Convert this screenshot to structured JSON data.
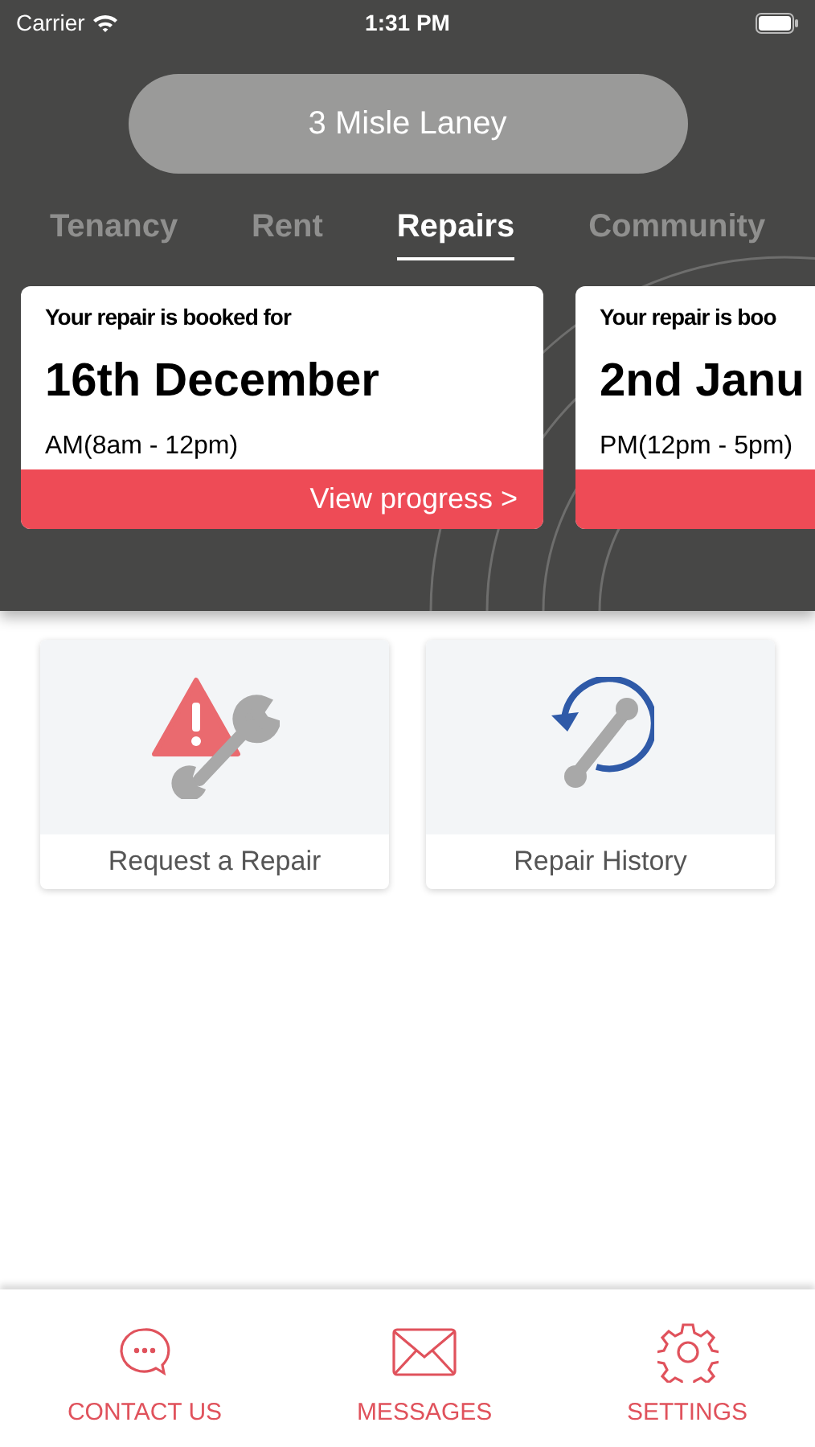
{
  "status_bar": {
    "carrier": "Carrier",
    "time": "1:31 PM"
  },
  "property": {
    "label": "3 Misle Laney"
  },
  "tabs": [
    {
      "label": "Tenancy",
      "selected": false
    },
    {
      "label": "Rent",
      "selected": false
    },
    {
      "label": "Repairs",
      "selected": true
    },
    {
      "label": "Community",
      "selected": false
    }
  ],
  "bookings": [
    {
      "heading": "Your repair is booked for",
      "date": "16th December",
      "slot": "AM(8am - 12pm)",
      "action": "View progress >"
    },
    {
      "heading": "Your repair is boo",
      "date": "2nd Janu",
      "slot": "PM(12pm - 5pm)"
    }
  ],
  "tiles": [
    {
      "kind": "request",
      "label": "Request a Repair"
    },
    {
      "kind": "history",
      "label": "Repair History"
    }
  ],
  "bottom_nav": [
    {
      "kind": "chat",
      "label": "CONTACT US"
    },
    {
      "kind": "mail",
      "label": "MESSAGES"
    },
    {
      "kind": "gear",
      "label": "SETTINGS"
    }
  ]
}
